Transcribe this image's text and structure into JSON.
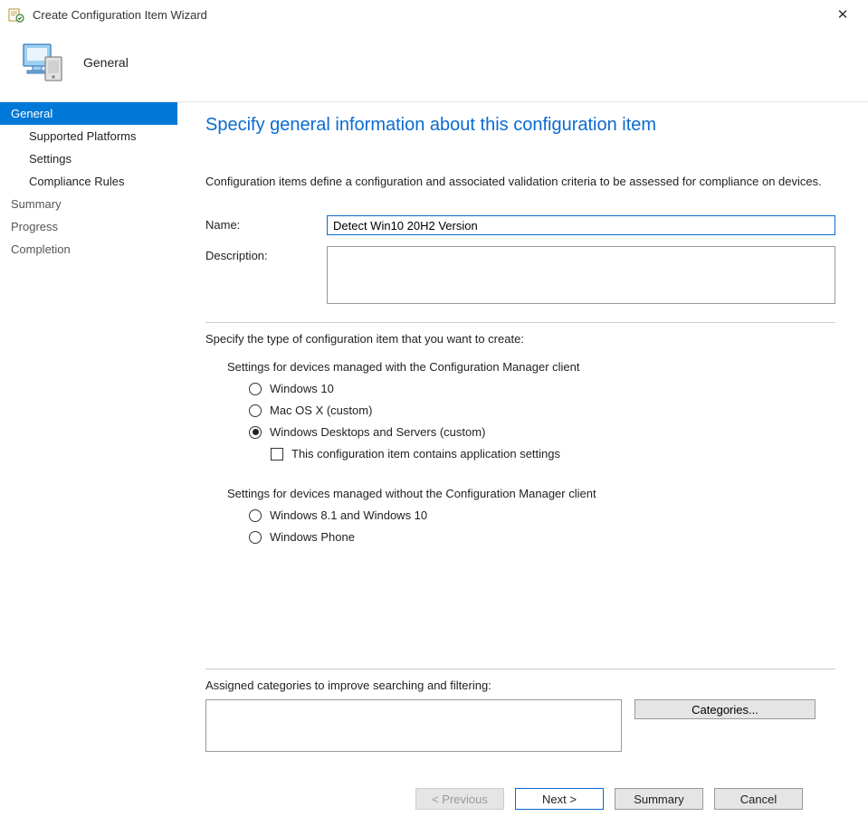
{
  "window": {
    "title": "Create Configuration Item Wizard"
  },
  "header": {
    "label": "General"
  },
  "sidebar": {
    "items": [
      {
        "label": "General",
        "sub": false,
        "active": true
      },
      {
        "label": "Supported Platforms",
        "sub": true,
        "active": false
      },
      {
        "label": "Settings",
        "sub": true,
        "active": false
      },
      {
        "label": "Compliance Rules",
        "sub": true,
        "active": false
      },
      {
        "label": "Summary",
        "sub": false,
        "active": false
      },
      {
        "label": "Progress",
        "sub": false,
        "active": false
      },
      {
        "label": "Completion",
        "sub": false,
        "active": false
      }
    ]
  },
  "main": {
    "title": "Specify general information about this configuration item",
    "intro": "Configuration items define a configuration and associated validation criteria to be assessed for compliance on devices.",
    "name_label": "Name:",
    "name_value": "Detect Win10 20H2 Version",
    "desc_label": "Description:",
    "desc_value": "",
    "type_section_label": "Specify the type of configuration item that you want to create:",
    "group_with_label": "Settings for devices managed with the Configuration Manager client",
    "radios_with": [
      {
        "label": "Windows 10",
        "selected": false
      },
      {
        "label": "Mac OS X (custom)",
        "selected": false
      },
      {
        "label": "Windows Desktops and Servers (custom)",
        "selected": true
      }
    ],
    "app_settings_checkbox": {
      "label": "This configuration item contains application settings",
      "checked": false
    },
    "group_without_label": "Settings for devices managed without the Configuration Manager client",
    "radios_without": [
      {
        "label": "Windows 8.1 and Windows 10",
        "selected": false
      },
      {
        "label": "Windows Phone",
        "selected": false
      }
    ],
    "categories_label": "Assigned categories to improve searching and filtering:",
    "categories_button": "Categories..."
  },
  "footer": {
    "previous": "< Previous",
    "next": "Next >",
    "summary": "Summary",
    "cancel": "Cancel"
  }
}
